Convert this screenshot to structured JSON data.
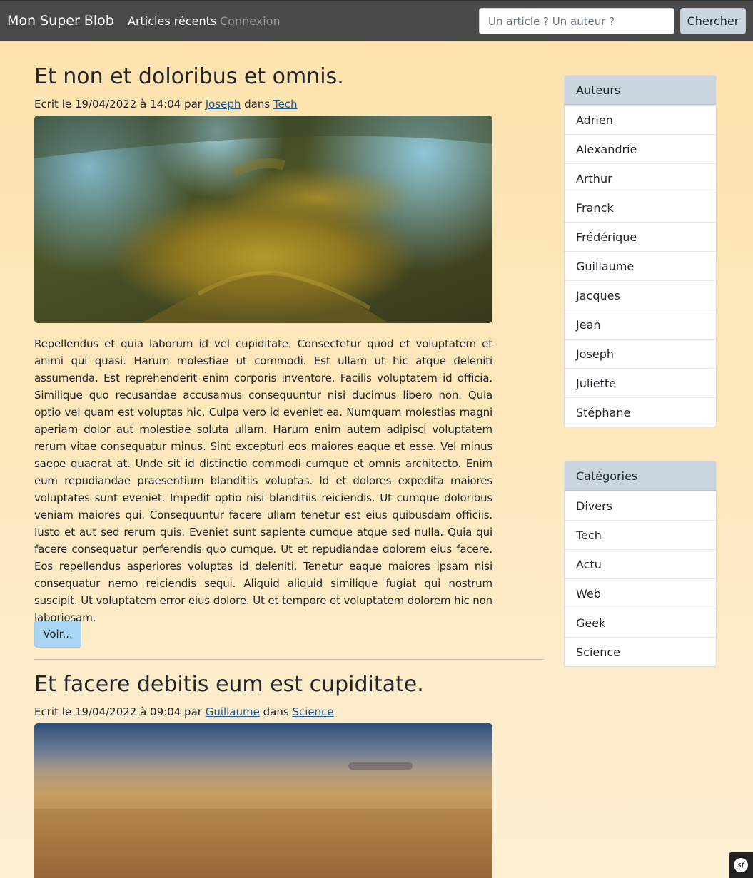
{
  "navbar": {
    "brand": "Mon Super Blob",
    "links": [
      "Articles récents",
      "Connexion"
    ],
    "search_placeholder": "Un article ? Un auteur ?",
    "search_button": "Chercher"
  },
  "articles": [
    {
      "title": "Et non et doloribus et omnis.",
      "meta_prefix": "Ecrit le 19/04/2022 à 14:04 par ",
      "author": "Joseph",
      "meta_middle": " dans ",
      "category": "Tech",
      "body": "Repellendus et quia laborum id vel cupiditate. Consectetur quod et voluptatem et animi qui quasi. Harum molestiae ut commodi. Est ullam ut hic atque deleniti assumenda. Est reprehenderit enim corporis inventore. Facilis voluptatem id officia. Similique quo recusandae accusamus consequuntur nisi ducimus libero non. Quia optio vel quam est voluptas hic. Culpa vero id eveniet ea. Numquam molestias magni aperiam dolor aut molestiae soluta ullam. Harum enim autem adipisci voluptatem rerum vitae consequatur minus. Sint excepturi eos maiores eaque et esse. Vel minus saepe quaerat at. Unde sit id distinctio commodi cumque et omnis architecto. Enim eum repudiandae praesentium blanditiis voluptas. Id et dolores expedita maiores voluptates sunt eveniet. Impedit optio nisi blanditiis reiciendis. Ut cumque doloribus veniam maiores qui. Consequuntur facere ullam tenetur est eius quibusdam officiis. Iusto et aut sed rerum quis. Eveniet sunt sapiente cumque atque sed nulla. Quia qui facere consequatur perferendis quo cumque. Ut et repudiandae dolorem eius facere. Eos repellendus asperiores voluptas id deleniti. Tenetur eaque maiores ipsam nisi consequatur nemo reiciendis sequi. Aliquid aliquid similique fugiat qui nostrum suscipit. Ut voluptatem error eius dolore. Ut et tempore et voluptatem dolorem hic non laboriosam.",
      "button": "Voir..."
    },
    {
      "title": "Et facere debitis eum est cupiditate.",
      "meta_prefix": "Ecrit le 19/04/2022 à 09:04 par ",
      "author": "Guillaume",
      "meta_middle": " dans ",
      "category": "Science"
    }
  ],
  "sidebar": {
    "authors": {
      "header": "Auteurs",
      "items": [
        "Adrien",
        "Alexandrie",
        "Arthur",
        "Franck",
        "Frédérique",
        "Guillaume",
        "Jacques",
        "Jean",
        "Joseph",
        "Juliette",
        "Stéphane"
      ]
    },
    "categories": {
      "header": "Catégories",
      "items": [
        "Divers",
        "Tech",
        "Actu",
        "Web",
        "Geek",
        "Science"
      ]
    }
  },
  "debug_badge": {
    "icon": "symfony-toolbar-icon",
    "glyph": "sf"
  }
}
